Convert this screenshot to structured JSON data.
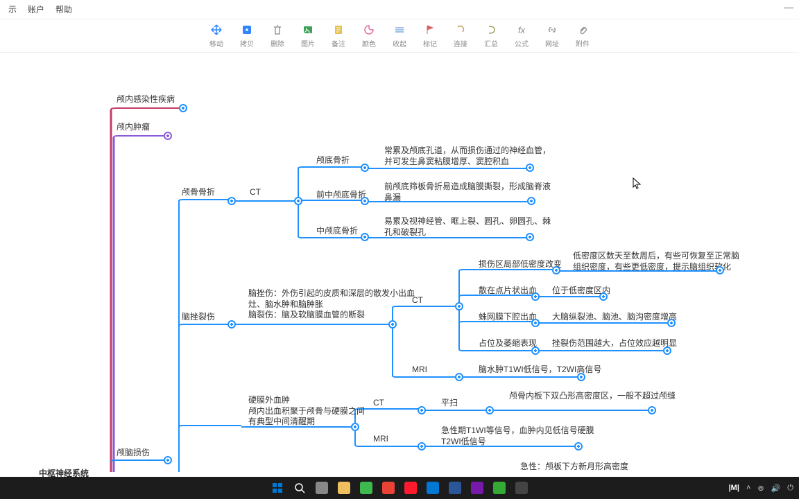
{
  "menu": {
    "items": [
      "账户",
      "帮助"
    ],
    "partial": "示"
  },
  "toolbar": [
    {
      "label": "移动",
      "icon": "move",
      "color": "#2f86ff"
    },
    {
      "label": "拷贝",
      "icon": "copy",
      "color": "#2f86ff"
    },
    {
      "label": "删除",
      "icon": "trash",
      "color": "#999"
    },
    {
      "label": "图片",
      "icon": "image",
      "color": "#3fa05a"
    },
    {
      "label": "备注",
      "icon": "note",
      "color": "#e6c24a"
    },
    {
      "label": "颜色",
      "icon": "palette",
      "color": "#e76aa0"
    },
    {
      "label": "收起",
      "icon": "collapse",
      "color": "#7da7e0"
    },
    {
      "label": "标记",
      "icon": "flag",
      "color": "#d86060"
    },
    {
      "label": "连接",
      "icon": "link",
      "color": "#c0a060"
    },
    {
      "label": "汇总",
      "icon": "summary",
      "color": "#a0a060"
    },
    {
      "label": "公式",
      "icon": "fx",
      "color": "#888"
    },
    {
      "label": "网址",
      "icon": "url",
      "color": "#999"
    },
    {
      "label": "附件",
      "icon": "attach",
      "color": "#999"
    }
  ],
  "root_partial": "中枢神经系统",
  "nodes": {
    "n1": "颅内感染性疾病",
    "n2": "颅内肿瘤",
    "n3": "颅骨骨折",
    "n4": "CT",
    "n5": "颅底骨折",
    "n5d": "常累及颅底孔道，从而损伤通过的神经血管，\n并可发生鼻窦粘膜增厚、窦腔积血",
    "n6": "前中颅底骨折",
    "n6d": "前颅底筛板骨折易造成脑膜撕裂，形成脑脊液\n鼻漏",
    "n7": "中颅底骨折",
    "n7d": "易累及视神经管、眶上裂、圆孔、卵圆孔、棘\n孔和破裂孔",
    "n8": "脑挫裂伤",
    "n8d": "脑挫伤：外伤引起的皮质和深层的散发小出血\n灶、脑水肿和脑肿胀\n脑裂伤：脑及软脑膜血管的断裂",
    "n9": "CT",
    "n10": "损伤区局部低密度改变",
    "n10d": "低密度区数天至数周后，有些可恢复至正常脑\n组织密度，有些更低密度，提示脑组织软化",
    "n11": "散在点片状出血",
    "n11d": "位于低密度区内",
    "n12": "蛛网膜下腔出血",
    "n12d": "大脑纵裂池、脑池、脑沟密度增高",
    "n13": "占位及萎缩表现",
    "n13d": "挫裂伤范围越大，占位效应越明显",
    "n14": "MRI",
    "n14d": "脑水肿T1WI低信号，T2WI高信号",
    "n15": "硬膜外血肿\n颅内出血积聚于颅骨与硬膜之间\n有典型中间清醒期",
    "n16": "CT",
    "n17": "平扫",
    "n17d": "颅骨内板下双凸形高密度区，一般不超过颅缝",
    "n18": "MRI",
    "n18d": "急性期T1WI等信号，血肿内见低信号硬膜\nT2WI低信号",
    "n19": "颅脑损伤",
    "n20": "急性：颅板下方新月形高密度"
  },
  "taskbar_icons": [
    "start",
    "search",
    "taskview",
    "explorer",
    "wechat",
    "chrome",
    "opera",
    "edge",
    "word",
    "onenote",
    "mubu",
    "terminal"
  ],
  "systray": [
    "mubu-logo",
    "chevron",
    "wifi",
    "volume",
    "battery"
  ]
}
